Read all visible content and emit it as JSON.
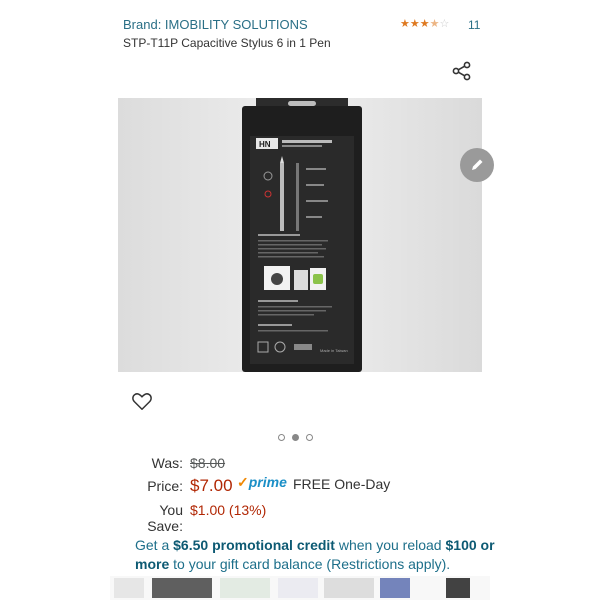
{
  "header": {
    "brand": "Brand: IMOBILITY SOLUTIONS",
    "rating_count": "11",
    "rating_value": 3.5,
    "title": "STP-T11P Capacitive Stylus 6 in 1 Pen"
  },
  "product_image": {
    "package_logo": "HN",
    "package_small_text": "Made in Taiwan"
  },
  "carousel": {
    "pages": 3,
    "active_index": 1
  },
  "pricing": {
    "was_label": "Was:",
    "was_value": "$8.00",
    "price_label": "Price:",
    "price_value": "$7.00",
    "prime_label": "prime",
    "delivery": "FREE One-Day",
    "save_label": "You Save:",
    "save_value": "$1.00 (13%)"
  },
  "promo": {
    "part1": "Get a ",
    "bold1": "$6.50 promotional credit",
    "part2": " when you reload ",
    "bold2": "$100 or more",
    "part3": " to your gift card balance (Restrictions apply)."
  },
  "colors": {
    "link": "#2a6f86",
    "price": "#b12704",
    "prime": "#1b8fc7",
    "star": "#de7921"
  },
  "icons": [
    "share-icon",
    "edit-icon",
    "heart-icon",
    "check-icon"
  ]
}
